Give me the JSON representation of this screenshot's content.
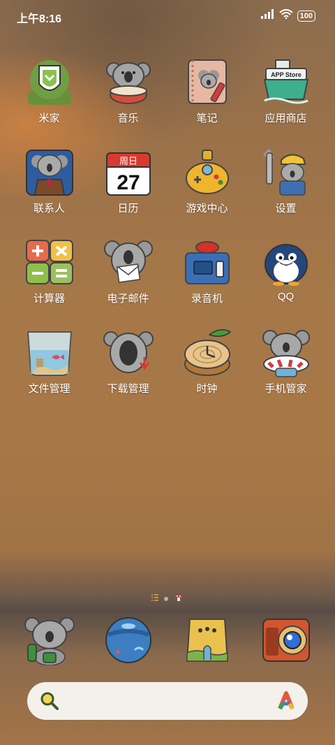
{
  "status_bar": {
    "time": "上午8:16",
    "battery": "100"
  },
  "apps": [
    {
      "label": "米家",
      "icon": "mijia-icon"
    },
    {
      "label": "音乐",
      "icon": "music-icon"
    },
    {
      "label": "笔记",
      "icon": "notes-icon"
    },
    {
      "label": "应用商店",
      "icon": "app-store-icon"
    },
    {
      "label": "联系人",
      "icon": "contacts-icon"
    },
    {
      "label": "日历",
      "icon": "calendar-icon"
    },
    {
      "label": "游戏中心",
      "icon": "game-center-icon"
    },
    {
      "label": "设置",
      "icon": "settings-icon"
    },
    {
      "label": "计算器",
      "icon": "calculator-icon"
    },
    {
      "label": "电子邮件",
      "icon": "email-icon"
    },
    {
      "label": "录音机",
      "icon": "recorder-icon"
    },
    {
      "label": "QQ",
      "icon": "qq-icon"
    },
    {
      "label": "文件管理",
      "icon": "file-manager-icon"
    },
    {
      "label": "下载管理",
      "icon": "download-manager-icon"
    },
    {
      "label": "时钟",
      "icon": "clock-icon"
    },
    {
      "label": "手机管家",
      "icon": "security-icon"
    }
  ],
  "calendar": {
    "weekday": "周日",
    "day": "27"
  },
  "app_store_text": "APP Store",
  "dock": [
    {
      "icon": "koala-phone-icon"
    },
    {
      "icon": "globe-browser-icon"
    },
    {
      "icon": "gallery-bag-icon"
    },
    {
      "icon": "camera-icon"
    }
  ],
  "search": {
    "icon": "search-icon",
    "assistant_icon": "assistant-icon"
  }
}
